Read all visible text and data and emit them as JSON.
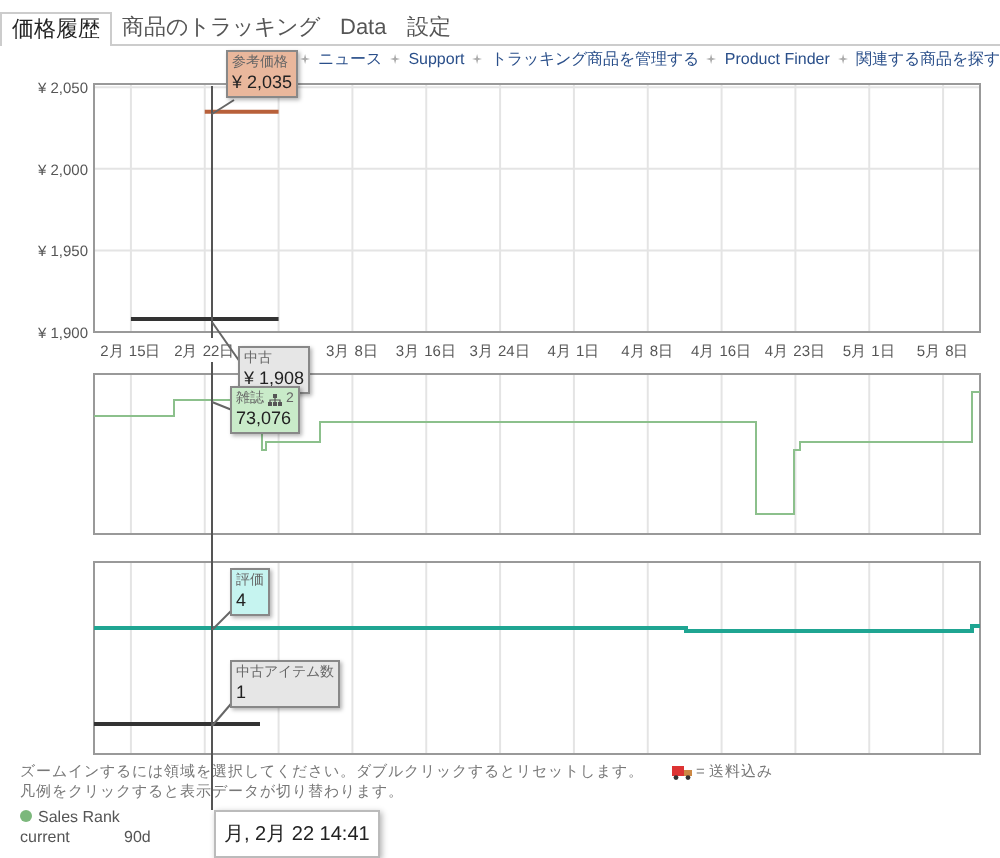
{
  "tabs": [
    {
      "label": "価格履歴",
      "selected": true
    },
    {
      "label": "商品のトラッキング",
      "selected": false
    },
    {
      "label": "Data",
      "selected": false
    },
    {
      "label": "設定",
      "selected": false
    }
  ],
  "nav_links": [
    "ニュース",
    "Support",
    "トラッキング商品を管理する",
    "Product Finder",
    "関連する商品を探す"
  ],
  "price_chart": {
    "chart_data": {
      "type": "line",
      "categories": [
        "2月 15日",
        "2月 22日",
        null,
        "3月 8日",
        "3月 16日",
        "3月 24日",
        "4月 1日",
        "4月 8日",
        "4月 16日",
        "4月 23日",
        "5月 1日",
        "5月 8日"
      ],
      "ylim": [
        1900,
        2052
      ],
      "grid": true,
      "yticks": [
        {
          "value": 1900,
          "label": "¥ 1,900"
        },
        {
          "value": 1950,
          "label": "¥ 1,950"
        },
        {
          "value": 2000,
          "label": "¥ 2,000"
        },
        {
          "value": 2050,
          "label": "¥ 2,050"
        }
      ],
      "series": [
        {
          "name": "参考価格",
          "color": "#b8603a",
          "values": [
            null,
            2035,
            2035,
            null,
            null,
            null,
            null,
            null,
            null,
            null,
            null,
            null
          ]
        },
        {
          "name": "中古",
          "color": "#333333",
          "values": [
            1908,
            1908,
            1908,
            null,
            null,
            null,
            null,
            null,
            null,
            null,
            null,
            null
          ]
        }
      ]
    }
  },
  "tooltips": [
    {
      "value": "¥ 2,035",
      "color": "#e9b79c"
    },
    {
      "value": "¥ 1,908",
      "color": "#e6e6e6"
    },
    {
      "label": "雑誌",
      "rank": "2",
      "value": "73,076",
      "color": "#c9ebc9"
    },
    {
      "label": "評価",
      "value": "4",
      "color": "#c6f4f0"
    },
    {
      "label": "中古アイテム数",
      "value": "1",
      "color": "#e6e6e6"
    }
  ],
  "cursor_time": "月, 2月 22 14:41",
  "hints": [
    "ズームインするには領域を選択してください。ダブルクリックするとリセットします。",
    "凡例をクリックすると表示データが切り替わります。"
  ],
  "shipping_legend": "= 送料込み",
  "legend": [
    {
      "name": "Sales Rank",
      "color": "#7cb87c"
    }
  ],
  "stats_header": [
    "current",
    "90d"
  ]
}
